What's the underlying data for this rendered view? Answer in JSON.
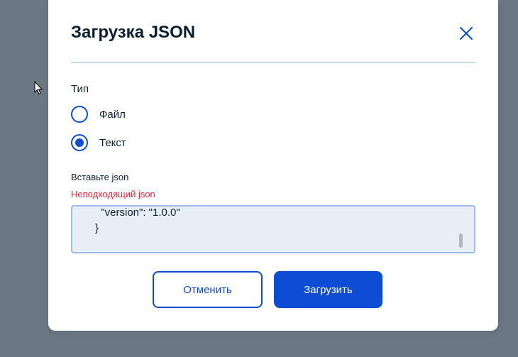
{
  "dialog": {
    "title": "Загрузка JSON",
    "type_label": "Тип",
    "options": [
      {
        "label": "Файл",
        "selected": false
      },
      {
        "label": "Текст",
        "selected": true
      }
    ],
    "field_label": "Вставьте json",
    "error": "Неподходящий json",
    "textarea_value": "\"version\": \"1.0.0\"\n}",
    "cancel_label": "Отменить",
    "submit_label": "Загрузить"
  },
  "colors": {
    "accent": "#0d4cd3",
    "error": "#e1283d",
    "overlay": "#6b7884",
    "text": "#0b1f33"
  },
  "icons": {
    "close": "close-icon",
    "cursor": "mouse-pointer-icon"
  }
}
